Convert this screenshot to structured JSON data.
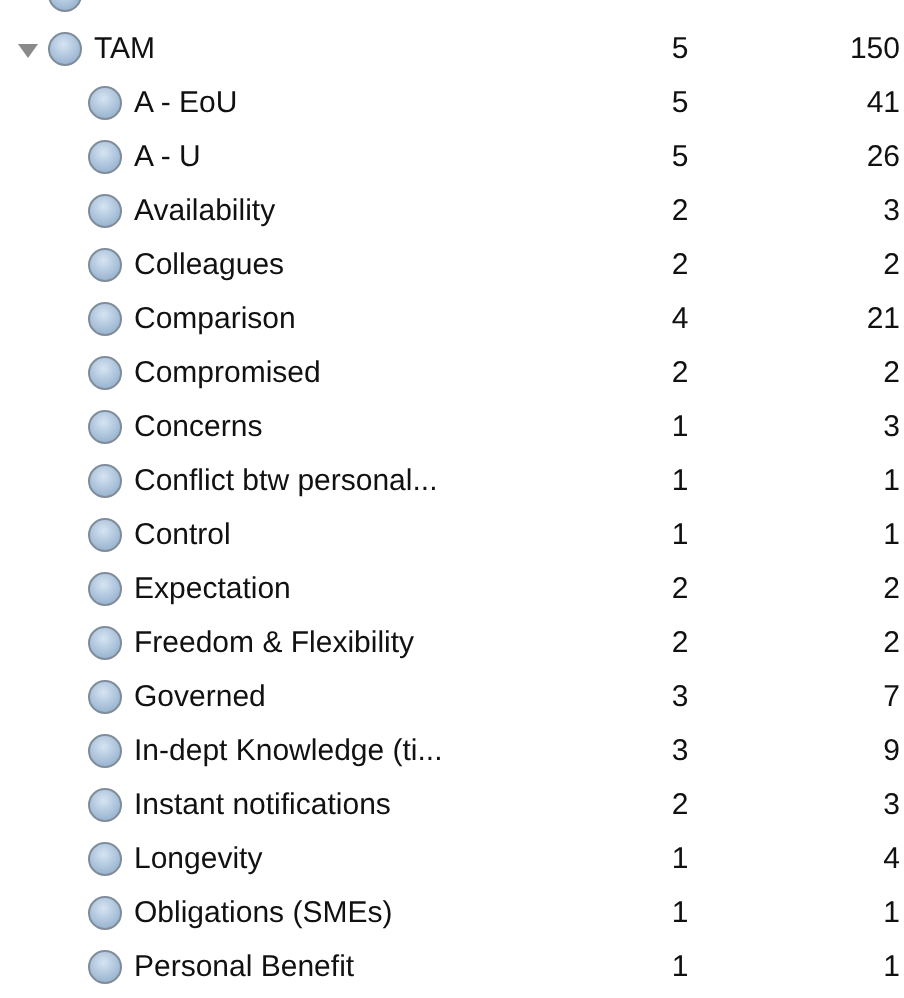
{
  "nodes": [
    {
      "kind": "clipped"
    },
    {
      "kind": "node",
      "name": "TAM",
      "files": "5",
      "references": "150",
      "expanded": true,
      "children": [
        {
          "name": "A - EoU",
          "files": "5",
          "references": "41"
        },
        {
          "name": "A - U",
          "files": "5",
          "references": "26"
        },
        {
          "name": "Availability",
          "files": "2",
          "references": "3"
        },
        {
          "name": "Colleagues",
          "files": "2",
          "references": "2"
        },
        {
          "name": "Comparison",
          "files": "4",
          "references": "21"
        },
        {
          "name": "Compromised",
          "files": "2",
          "references": "2"
        },
        {
          "name": "Concerns",
          "files": "1",
          "references": "3"
        },
        {
          "name": "Conflict btw personal...",
          "files": "1",
          "references": "1"
        },
        {
          "name": "Control",
          "files": "1",
          "references": "1"
        },
        {
          "name": "Expectation",
          "files": "2",
          "references": "2"
        },
        {
          "name": "Freedom & Flexibility",
          "files": "2",
          "references": "2"
        },
        {
          "name": "Governed",
          "files": "3",
          "references": "7"
        },
        {
          "name": "In-dept Knowledge (ti...",
          "files": "3",
          "references": "9"
        },
        {
          "name": "Instant notifications",
          "files": "2",
          "references": "3"
        },
        {
          "name": "Longevity",
          "files": "1",
          "references": "4"
        },
        {
          "name": "Obligations (SMEs)",
          "files": "1",
          "references": "1"
        },
        {
          "name": "Personal Benefit",
          "files": "1",
          "references": "1"
        }
      ]
    }
  ]
}
